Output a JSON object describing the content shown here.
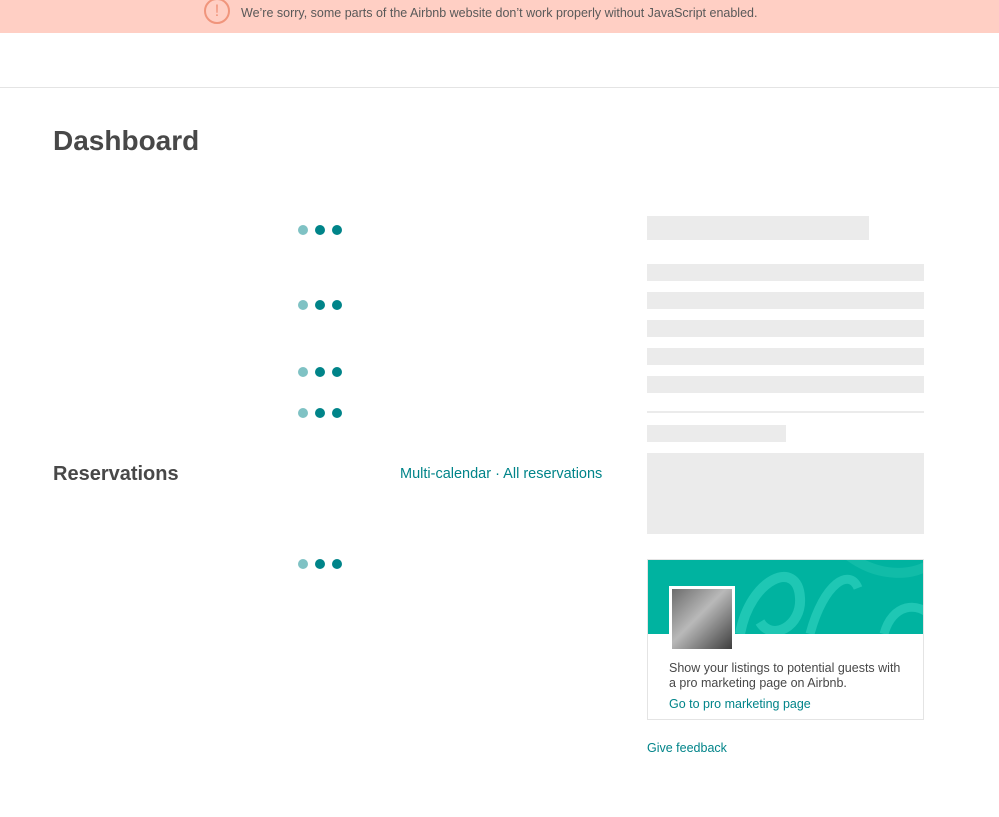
{
  "banner": {
    "icon": "exclamation-icon",
    "message": "We’re sorry, some parts of the Airbnb website don’t work properly without JavaScript enabled."
  },
  "page": {
    "title": "Dashboard"
  },
  "reservations": {
    "title": "Reservations",
    "multi_calendar_label": "Multi-calendar",
    "separator": " · ",
    "all_reservations_label": "All reservations"
  },
  "promo": {
    "text": "Show your listings to potential guests with a pro marketing page on Airbnb.",
    "link_label": "Go to pro marketing page"
  },
  "feedback": {
    "label": "Give feedback"
  },
  "colors": {
    "banner_bg": "#ffcfc4",
    "accent": "#008489",
    "loader_light": "#7fc2c4",
    "placeholder": "#ebebeb",
    "promo_bg": "#00b3a0"
  }
}
